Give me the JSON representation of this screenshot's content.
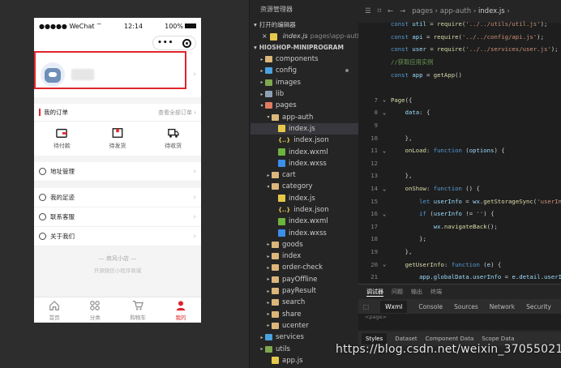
{
  "phone": {
    "status": {
      "carrier": "●●●●● WeChat",
      "wifi": "⌔",
      "time": "12:14",
      "battery": "100%"
    },
    "capsule": {
      "dots": "•••"
    },
    "orders": {
      "title": "我的订单",
      "view_all": "查看全部订单 ›"
    },
    "order_icons": [
      {
        "label": "待付款",
        "icon": "wallet-icon"
      },
      {
        "label": "待发货",
        "icon": "box-icon"
      },
      {
        "label": "待收货",
        "icon": "truck-icon"
      }
    ],
    "menu": [
      {
        "label": "地址管理",
        "icon": "location-icon"
      },
      {
        "label": "我的足迹",
        "icon": "footprint-icon"
      },
      {
        "label": "联系客服",
        "icon": "service-icon"
      },
      {
        "label": "关于我们",
        "icon": "info-icon"
      }
    ],
    "brand": {
      "name": "—  商风小店  —",
      "sub": "开源微信小程序商城"
    },
    "tabbar": [
      {
        "label": "首页",
        "icon": "home-icon"
      },
      {
        "label": "分类",
        "icon": "category-icon"
      },
      {
        "label": "购物车",
        "icon": "cart-icon"
      },
      {
        "label": "我的",
        "icon": "user-icon"
      }
    ],
    "accent_color": "#e0252b"
  },
  "explorer": {
    "title": "资源管理器",
    "open_editors_label": "打开的编辑器",
    "open_file": {
      "name": "index.js",
      "path": "pages\\app-auth"
    },
    "project_label": "HIOSHOP-MINIPROGRAM",
    "tree": [
      {
        "label": "components",
        "kind": "folder"
      },
      {
        "label": "config",
        "kind": "folder-cfg"
      },
      {
        "label": "images",
        "kind": "folder-img"
      },
      {
        "label": "lib",
        "kind": "folder-lib"
      },
      {
        "label": "pages",
        "kind": "folder-pages"
      },
      {
        "label": "app-auth",
        "kind": "folder"
      },
      {
        "label": "index.js",
        "kind": "js"
      },
      {
        "label": "index.json",
        "kind": "json"
      },
      {
        "label": "index.wxml",
        "kind": "wxml"
      },
      {
        "label": "index.wxss",
        "kind": "wxss"
      },
      {
        "label": "cart",
        "kind": "folder"
      },
      {
        "label": "category",
        "kind": "folder"
      },
      {
        "label": "index.js",
        "kind": "js"
      },
      {
        "label": "index.json",
        "kind": "json"
      },
      {
        "label": "index.wxml",
        "kind": "wxml"
      },
      {
        "label": "index.wxss",
        "kind": "wxss"
      },
      {
        "label": "goods",
        "kind": "folder"
      },
      {
        "label": "index",
        "kind": "folder"
      },
      {
        "label": "order-check",
        "kind": "folder"
      },
      {
        "label": "payOffline",
        "kind": "folder"
      },
      {
        "label": "payResult",
        "kind": "folder"
      },
      {
        "label": "search",
        "kind": "folder"
      },
      {
        "label": "share",
        "kind": "folder"
      },
      {
        "label": "ucenter",
        "kind": "folder"
      },
      {
        "label": "services",
        "kind": "folder-cfg"
      },
      {
        "label": "utils",
        "kind": "folder-img"
      },
      {
        "label": "app.js",
        "kind": "js"
      }
    ]
  },
  "editor": {
    "breadcrumb": {
      "a": "pages",
      "b": "app-auth",
      "c": "index.js"
    },
    "lines": [
      {
        "n": "",
        "segs": [
          [
            "kw",
            "const "
          ],
          [
            "var",
            "util"
          ],
          [
            "pl",
            " = "
          ],
          [
            "fn",
            "require"
          ],
          [
            "pl",
            "("
          ],
          [
            "str",
            "'../../utils/util.js'"
          ],
          [
            "pl",
            ");"
          ]
        ]
      },
      {
        "n": "",
        "segs": [
          [
            "kw",
            "const "
          ],
          [
            "var",
            "api"
          ],
          [
            "pl",
            " = "
          ],
          [
            "fn",
            "require"
          ],
          [
            "pl",
            "("
          ],
          [
            "str",
            "'../../config/api.js'"
          ],
          [
            "pl",
            ");"
          ]
        ]
      },
      {
        "n": "",
        "segs": [
          [
            "kw",
            "const "
          ],
          [
            "var",
            "user"
          ],
          [
            "pl",
            " = "
          ],
          [
            "fn",
            "require"
          ],
          [
            "pl",
            "("
          ],
          [
            "str",
            "'../../services/user.js'"
          ],
          [
            "pl",
            ");"
          ]
        ]
      },
      {
        "n": "",
        "segs": [
          [
            "cm",
            "//获取应用实例"
          ]
        ]
      },
      {
        "n": "",
        "segs": [
          [
            "kw",
            "const "
          ],
          [
            "var",
            "app"
          ],
          [
            "pl",
            " = "
          ],
          [
            "fn",
            "getApp"
          ],
          [
            "pl",
            "()"
          ]
        ]
      },
      {
        "n": "",
        "segs": []
      },
      {
        "n": "7",
        "segs": [
          [
            "fn",
            "Page"
          ],
          [
            "pl",
            "({"
          ]
        ]
      },
      {
        "n": "8",
        "segs": [
          [
            "pl",
            "    "
          ],
          [
            "prop",
            "data"
          ],
          [
            "pl",
            ": {"
          ]
        ]
      },
      {
        "n": "9",
        "segs": []
      },
      {
        "n": "10",
        "segs": [
          [
            "pl",
            "    },"
          ]
        ]
      },
      {
        "n": "11",
        "segs": [
          [
            "pl",
            "    "
          ],
          [
            "fn",
            "onLoad"
          ],
          [
            "pl",
            ": "
          ],
          [
            "kw",
            "function "
          ],
          [
            "pl",
            "("
          ],
          [
            "var",
            "options"
          ],
          [
            "pl",
            ") {"
          ]
        ]
      },
      {
        "n": "12",
        "segs": []
      },
      {
        "n": "13",
        "segs": [
          [
            "pl",
            "    },"
          ]
        ]
      },
      {
        "n": "14",
        "segs": [
          [
            "pl",
            "    "
          ],
          [
            "fn",
            "onShow"
          ],
          [
            "pl",
            ": "
          ],
          [
            "kw",
            "function "
          ],
          [
            "pl",
            "() {"
          ]
        ]
      },
      {
        "n": "15",
        "segs": [
          [
            "pl",
            "        "
          ],
          [
            "kw",
            "let "
          ],
          [
            "var",
            "userInfo"
          ],
          [
            "pl",
            " = "
          ],
          [
            "var",
            "wx"
          ],
          [
            "pl",
            "."
          ],
          [
            "fn",
            "getStorageSync"
          ],
          [
            "pl",
            "("
          ],
          [
            "str",
            "'userIn"
          ]
        ]
      },
      {
        "n": "16",
        "segs": [
          [
            "pl",
            "        "
          ],
          [
            "kw",
            "if "
          ],
          [
            "pl",
            "("
          ],
          [
            "var",
            "userInfo"
          ],
          [
            "pl",
            " != "
          ],
          [
            "str",
            "''"
          ],
          [
            "pl",
            ") {"
          ]
        ]
      },
      {
        "n": "17",
        "segs": [
          [
            "pl",
            "            "
          ],
          [
            "var",
            "wx"
          ],
          [
            "pl",
            "."
          ],
          [
            "fn",
            "navigateBack"
          ],
          [
            "pl",
            "();"
          ]
        ]
      },
      {
        "n": "18",
        "segs": [
          [
            "pl",
            "        };"
          ]
        ]
      },
      {
        "n": "19",
        "segs": [
          [
            "pl",
            "    },"
          ]
        ]
      },
      {
        "n": "20",
        "segs": [
          [
            "pl",
            "    "
          ],
          [
            "fn",
            "getUserInfo"
          ],
          [
            "pl",
            ": "
          ],
          [
            "kw",
            "function "
          ],
          [
            "pl",
            "("
          ],
          [
            "var",
            "e"
          ],
          [
            "pl",
            ") {"
          ]
        ]
      },
      {
        "n": "21",
        "segs": [
          [
            "pl",
            "        "
          ],
          [
            "var",
            "app"
          ],
          [
            "pl",
            "."
          ],
          [
            "var",
            "globalData"
          ],
          [
            "pl",
            "."
          ],
          [
            "var",
            "userInfo"
          ],
          [
            "pl",
            " = "
          ],
          [
            "var",
            "e"
          ],
          [
            "pl",
            "."
          ],
          [
            "var",
            "detail"
          ],
          [
            "pl",
            "."
          ],
          [
            "var",
            "userI"
          ]
        ]
      }
    ],
    "panel_tabs": [
      "调试器",
      "问题",
      "输出",
      "终端"
    ],
    "devtools_tabs": [
      "Wxml",
      "Console",
      "Sources",
      "Network",
      "Security"
    ],
    "devtools_body": "<page>",
    "style_tabs": [
      "Styles",
      "Dataset",
      "Component Data",
      "Scope Data"
    ]
  },
  "watermark": "https://blog.csdn.net/weixin_37055021"
}
